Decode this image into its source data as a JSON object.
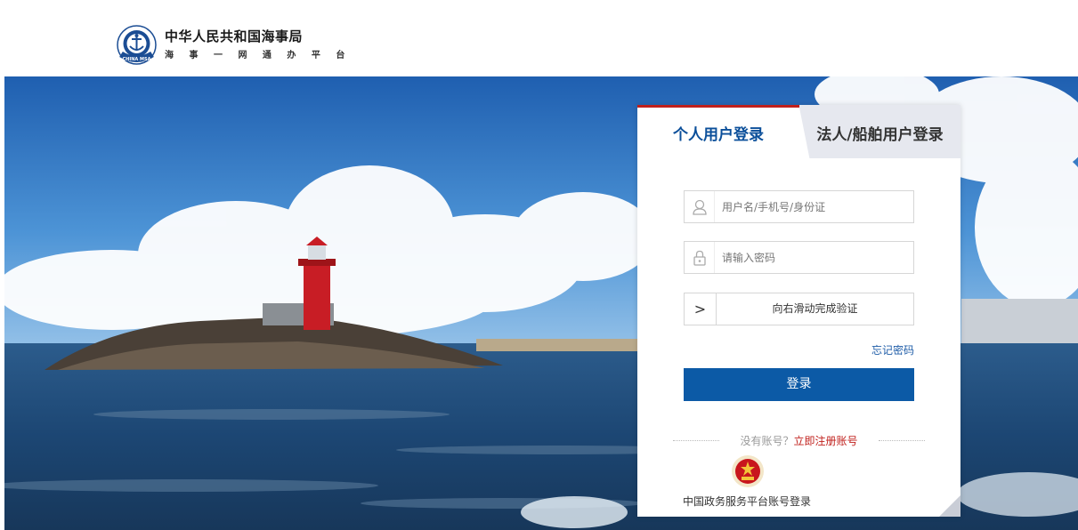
{
  "header": {
    "logo_icon": "maritime-anchor-emblem",
    "logo_badge_text": "CHINA MSA",
    "title": "中华人民共和国海事局",
    "subtitle": "海 事 一 网 通 办 平 台"
  },
  "hero": {
    "image": "lighthouse-seascape"
  },
  "login": {
    "tabs": [
      {
        "label": "个人用户登录",
        "active": true
      },
      {
        "label": "法人/船舶用户登录",
        "active": false
      }
    ],
    "username": {
      "placeholder": "用户名/手机号/身份证",
      "icon": "user-icon"
    },
    "password": {
      "placeholder": "请输入密码",
      "icon": "lock-icon"
    },
    "slider": {
      "handle_glyph": ">",
      "text": "向右滑动完成验证"
    },
    "forgot": "忘记密码",
    "submit": "登录",
    "register_question": "没有账号？",
    "register_link": "立即注册账号",
    "gov_icon": "national-emblem-icon",
    "gov_login": "中国政务服务平台账号登录"
  },
  "colors": {
    "primary": "#0c5aa6",
    "accent_red": "#c0201c",
    "tab_inactive": "#e6e8ef"
  }
}
